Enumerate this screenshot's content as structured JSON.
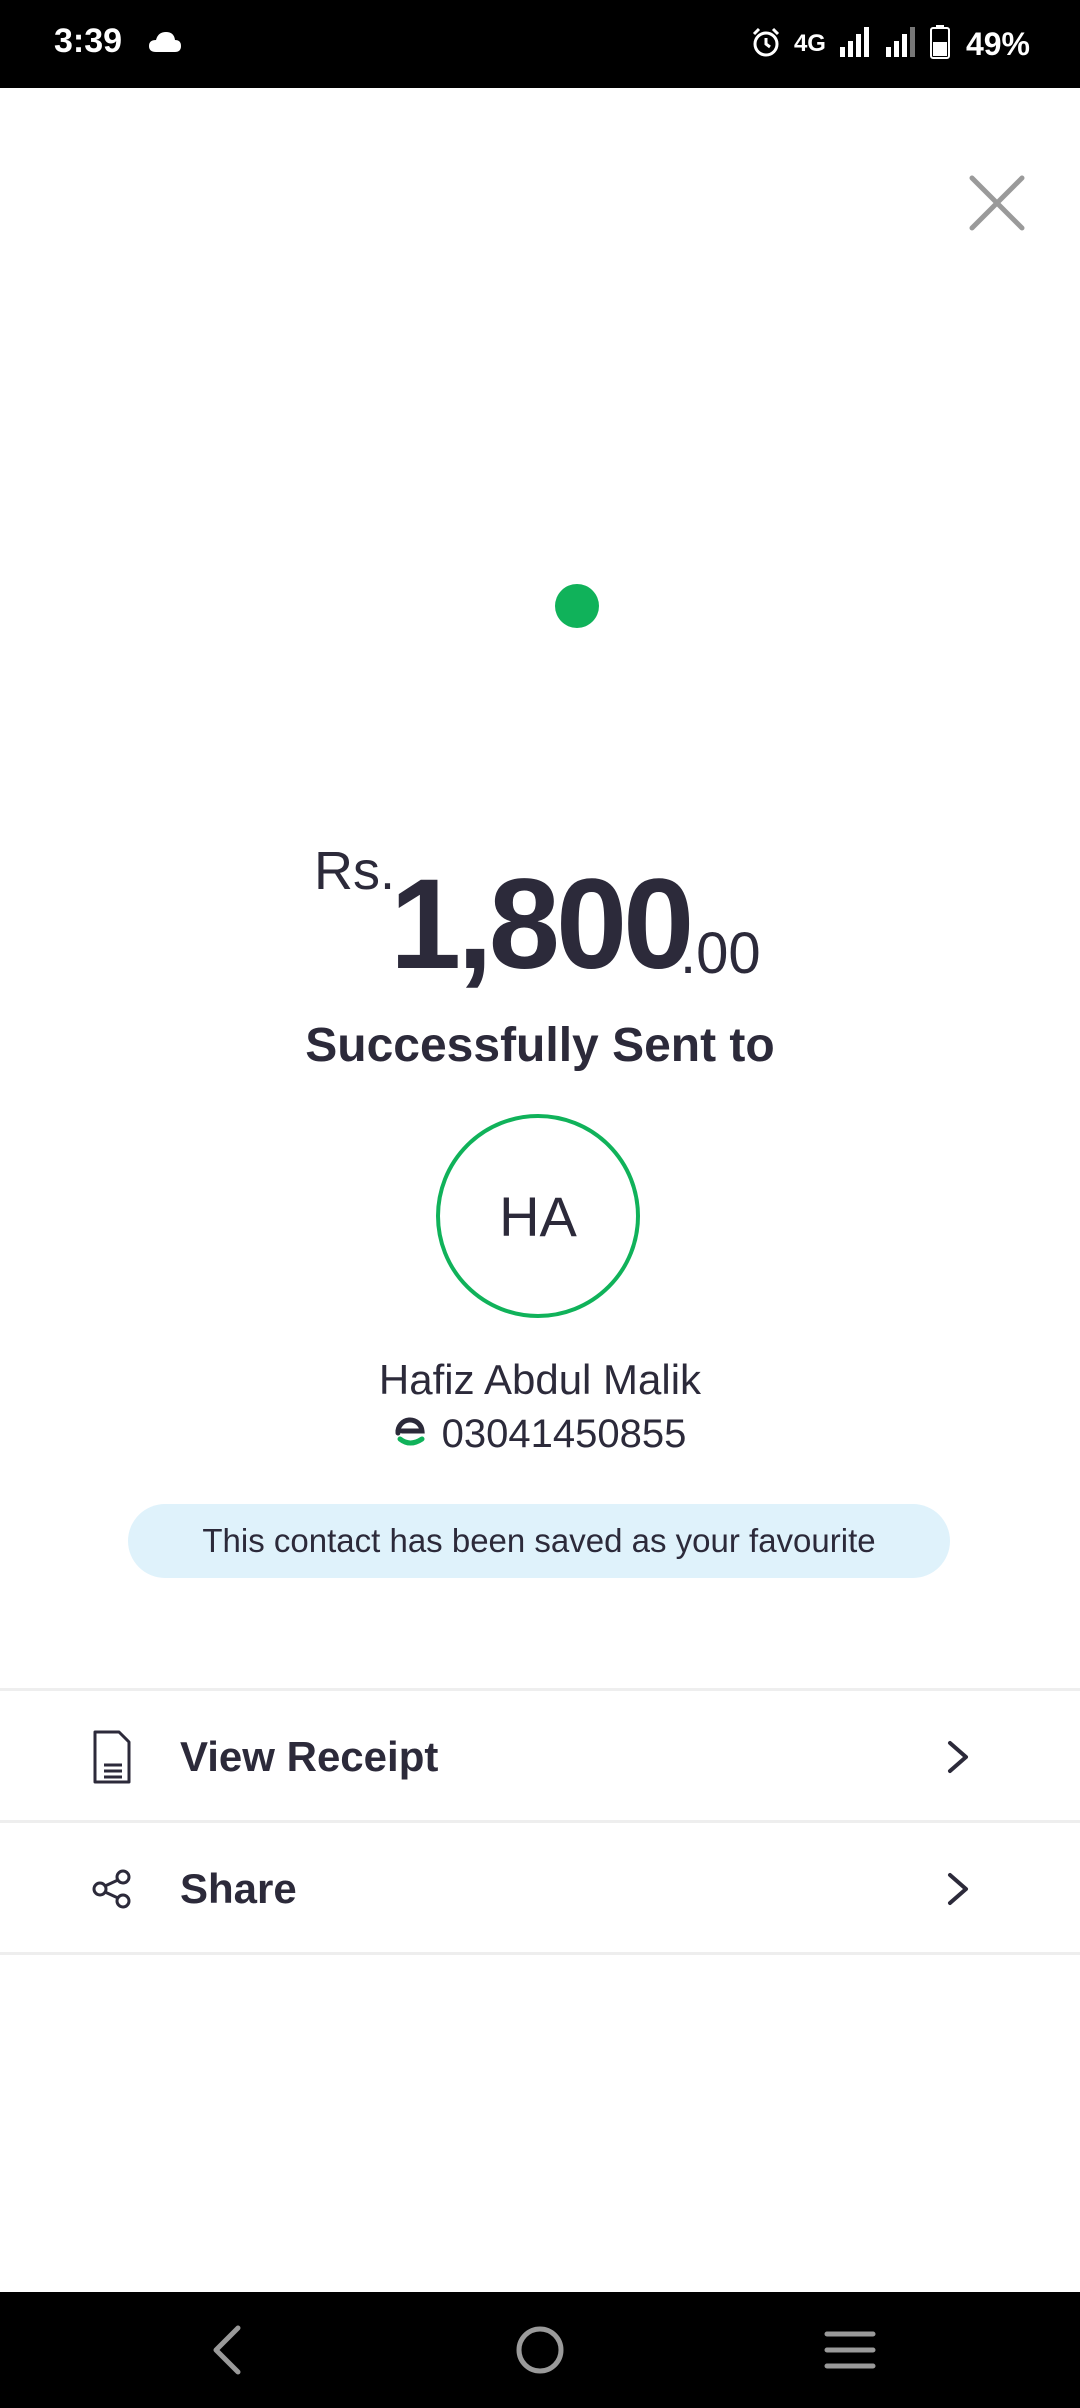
{
  "status_bar": {
    "time": "3:39",
    "network": "4G",
    "battery": "49%",
    "icons": [
      "cloud-icon",
      "alarm-icon",
      "signal-icon",
      "battery-icon"
    ]
  },
  "header": {
    "close_icon": "close-icon"
  },
  "amount": {
    "currency": "Rs.",
    "main": "1,800",
    "decimal": ".00"
  },
  "status_text": "Successfully Sent to",
  "recipient": {
    "initials": "HA",
    "name": "Hafiz Abdul Malik",
    "number": "03041450855",
    "wallet_icon": "easypaisa-logo-icon"
  },
  "favourite_banner": "This contact has been saved as your favourite",
  "actions": [
    {
      "label": "View Receipt",
      "icon": "receipt-icon"
    },
    {
      "label": "Share",
      "icon": "share-icon"
    }
  ],
  "colors": {
    "accent_green": "#10b25a",
    "text_dark": "#2c2a3a",
    "banner_bg": "#dff2fb"
  }
}
